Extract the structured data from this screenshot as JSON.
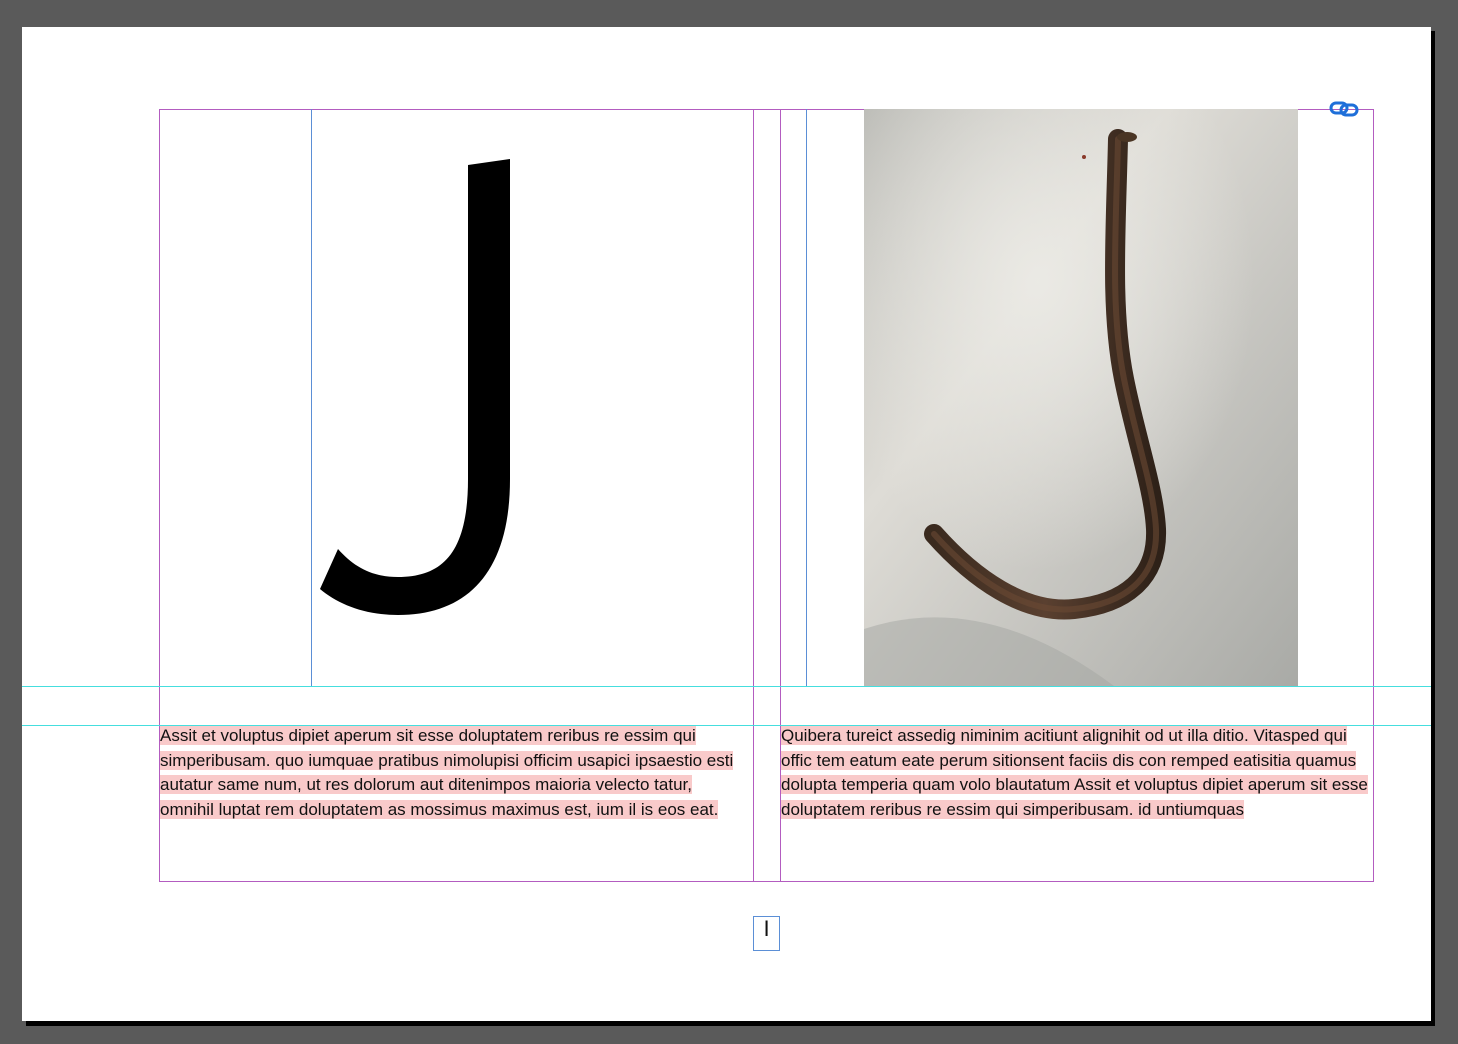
{
  "document": {
    "spread": {
      "left_page": {
        "display_letter": "J",
        "body_text": "Assit et voluptus dipiet aperum sit esse doluptatem reribus re essim qui simperibusam. quo iumquae pratibus nimolupisi officim usapici ipsaestio esti autatur same num, ut res dolorum aut ditenimpos maioria velecto tatur, omnihil luptat rem doluptatem as mossimus maximus est, ium il is eos eat."
      },
      "right_page": {
        "image": "rusty-metal-hook-photo",
        "body_text": "Quibera tureict assedig niminim acitiunt alignihit od ut illa ditio. Vitasped qui offic tem eatum eate perum sitionsent faciis dis con remped eatisitia quamus dolupta temperia quam volo blautatum  Assit et voluptus dipiet aperum sit esse doluptatem reribus re essim qui simperibusam. id untiumquas"
      },
      "page_number_marker": "I"
    },
    "colors": {
      "pasteboard": "#5a5a5a",
      "margin_guide": "#b35cc0",
      "column_guide": "#5b8fd6",
      "ruler_guide": "#45dede",
      "text_highlight": "#f9caca",
      "link_badge": "#1e6fd9"
    },
    "icons": {
      "linked_content": "link-icon"
    }
  }
}
